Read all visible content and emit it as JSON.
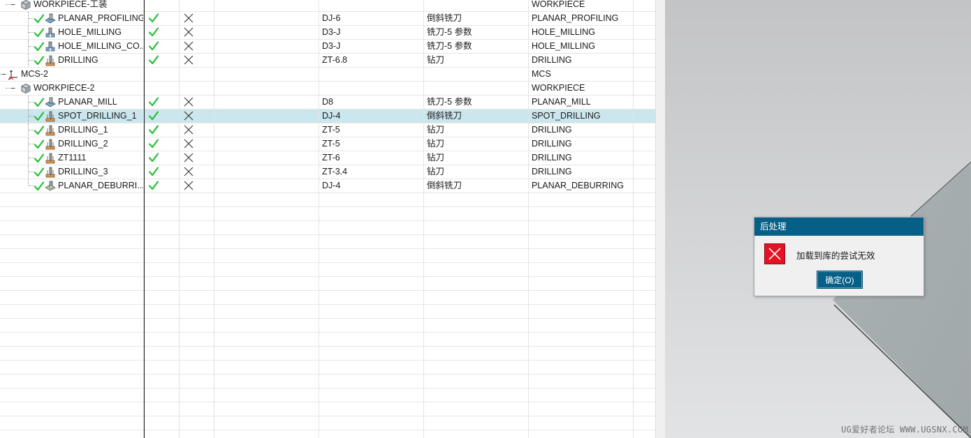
{
  "navigator": {
    "rows": [
      {
        "name": "WORKPIECE-工装",
        "level": 1,
        "icon": "workpiece-icon",
        "expander": true,
        "ok": false,
        "tool": "",
        "tooltype": "",
        "type": "WORKPIECE"
      },
      {
        "name": "PLANAR_PROFILING",
        "level": 2,
        "icon": "planar-mill-op-icon",
        "ok": true,
        "tool": "DJ-6",
        "tooltype": "倒斜铣刀",
        "type": "PLANAR_PROFILING"
      },
      {
        "name": "HOLE_MILLING",
        "level": 2,
        "icon": "hole-milling-op-icon",
        "ok": true,
        "tool": "D3-J",
        "tooltype": "铣刀-5 参数",
        "type": "HOLE_MILLING"
      },
      {
        "name": "HOLE_MILLING_CO...",
        "level": 2,
        "icon": "hole-milling-op-icon",
        "ok": true,
        "tool": "D3-J",
        "tooltype": "铣刀-5 参数",
        "type": "HOLE_MILLING"
      },
      {
        "name": "DRILLING",
        "level": 2,
        "icon": "drilling-op-icon",
        "ok": true,
        "tool": "ZT-6.8",
        "tooltype": "钻刀",
        "type": "DRILLING"
      },
      {
        "name": "MCS-2",
        "level": 0,
        "icon": "mcs-icon",
        "expander": true,
        "ok": false,
        "tool": "",
        "tooltype": "",
        "type": "MCS"
      },
      {
        "name": "WORKPIECE-2",
        "level": 1,
        "icon": "workpiece-icon",
        "expander": true,
        "ok": false,
        "tool": "",
        "tooltype": "",
        "type": "WORKPIECE"
      },
      {
        "name": "PLANAR_MILL",
        "level": 2,
        "icon": "planar-mill-op-icon",
        "ok": true,
        "tool": "D8",
        "tooltype": "铣刀-5 参数",
        "type": "PLANAR_MILL"
      },
      {
        "name": "SPOT_DRILLING_1",
        "level": 2,
        "icon": "drilling-op-icon",
        "ok": true,
        "selected": true,
        "tool": "DJ-4",
        "tooltype": "倒斜铣刀",
        "type": "SPOT_DRILLING"
      },
      {
        "name": "DRILLING_1",
        "level": 2,
        "icon": "drilling-op-icon",
        "ok": true,
        "tool": "ZT-5",
        "tooltype": "钻刀",
        "type": "DRILLING"
      },
      {
        "name": "DRILLING_2",
        "level": 2,
        "icon": "drilling-op-icon",
        "ok": true,
        "tool": "ZT-5",
        "tooltype": "钻刀",
        "type": "DRILLING"
      },
      {
        "name": "ZT1111",
        "level": 2,
        "icon": "drilling-op-icon",
        "ok": true,
        "tool": "ZT-6",
        "tooltype": "钻刀",
        "type": "DRILLING"
      },
      {
        "name": "DRILLING_3",
        "level": 2,
        "icon": "drilling-op-icon",
        "ok": true,
        "tool": "ZT-3.4",
        "tooltype": "钻刀",
        "type": "DRILLING"
      },
      {
        "name": "PLANAR_DEBURRI...",
        "level": 2,
        "icon": "deburring-op-icon",
        "ok": true,
        "last": true,
        "tool": "DJ-4",
        "tooltype": "倒斜铣刀",
        "type": "PLANAR_DEBURRING"
      }
    ],
    "empty_row_count": 18
  },
  "dialog": {
    "title": "后处理",
    "message": "加载到库的尝试无效",
    "ok_label": "确定(O)"
  },
  "watermark": "UG爱好者论坛 WWW.UGSNX.COM",
  "colors": {
    "selected_row": "#cce6ee",
    "dialog_title_bar": "#065f86",
    "error_icon": "#e81123",
    "check_green": "#22c033"
  }
}
